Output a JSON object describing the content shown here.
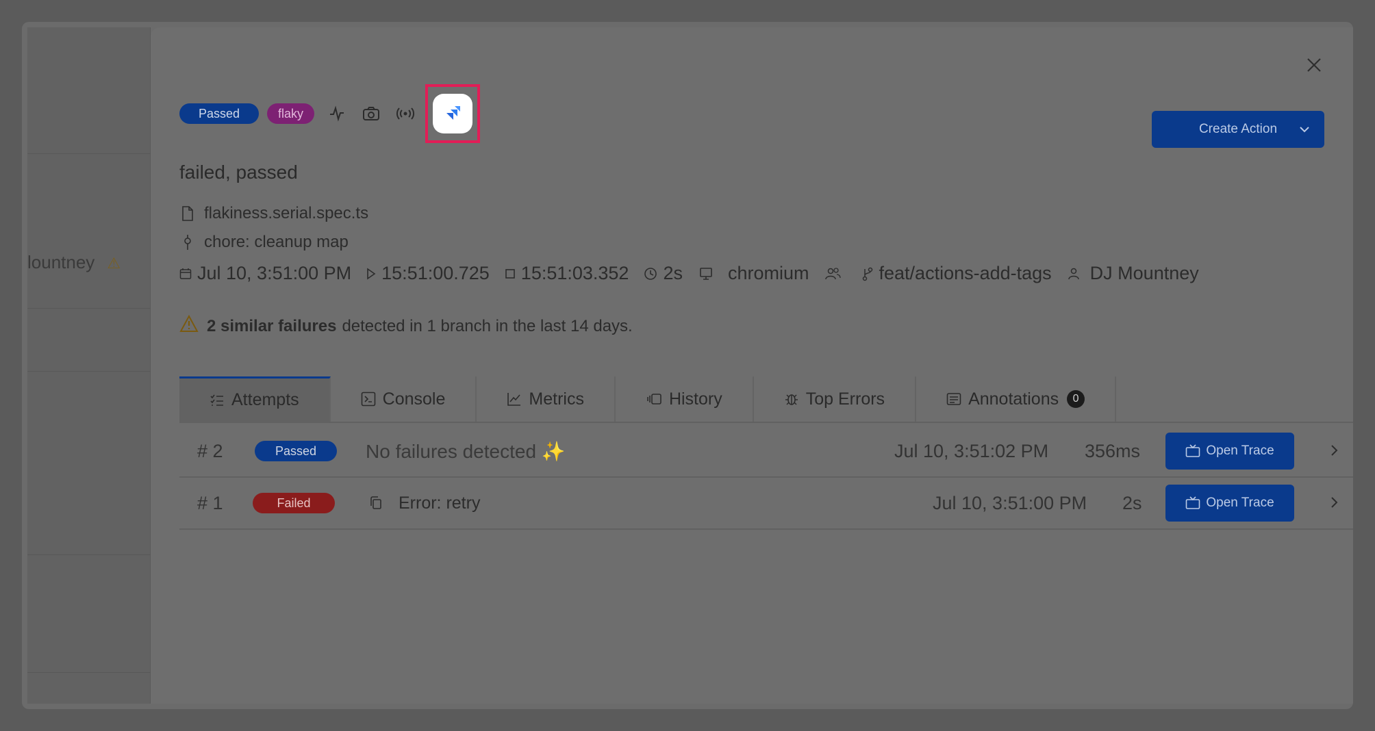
{
  "background": {
    "partial_name": "lountney"
  },
  "header": {
    "status_badge": "Passed",
    "flaky_badge": "flaky",
    "icons": [
      "pulse-icon",
      "camera-swap-icon",
      "broadcast-icon",
      "jira-icon"
    ],
    "create_action_label": "Create Action"
  },
  "test": {
    "title": "failed, passed",
    "file": "flakiness.serial.spec.ts",
    "commit": "chore: cleanup map",
    "date": "Jul 10, 3:51:00 PM",
    "start_time": "15:51:00.725",
    "end_time": "15:51:03.352",
    "duration": "2s",
    "browser": "chromium",
    "branch": "feat/actions-add-tags",
    "author": "DJ Mountney"
  },
  "similar_failures": {
    "bold": "2 similar failures",
    "rest": "detected in 1 branch in the last 14 days."
  },
  "tabs": [
    {
      "label": "Attempts",
      "icon": "list-icon"
    },
    {
      "label": "Console",
      "icon": "terminal-icon"
    },
    {
      "label": "Metrics",
      "icon": "chart-icon"
    },
    {
      "label": "History",
      "icon": "history-icon"
    },
    {
      "label": "Top Errors",
      "icon": "bug-icon"
    },
    {
      "label": "Annotations",
      "icon": "note-icon",
      "count": "0"
    }
  ],
  "attempts": [
    {
      "num": "# 2",
      "status": "Passed",
      "message": "No failures detected ✨",
      "time": "Jul 10, 3:51:02 PM",
      "duration": "356ms",
      "trace_label": "Open Trace"
    },
    {
      "num": "# 1",
      "status": "Failed",
      "message": "Error: retry",
      "time": "Jul 10, 3:51:00 PM",
      "duration": "2s",
      "trace_label": "Open Trace"
    }
  ],
  "colors": {
    "accent": "#0a3a8c",
    "flaky": "#7d2173",
    "failed": "#8a1c1c",
    "highlight": "#e21d57"
  }
}
